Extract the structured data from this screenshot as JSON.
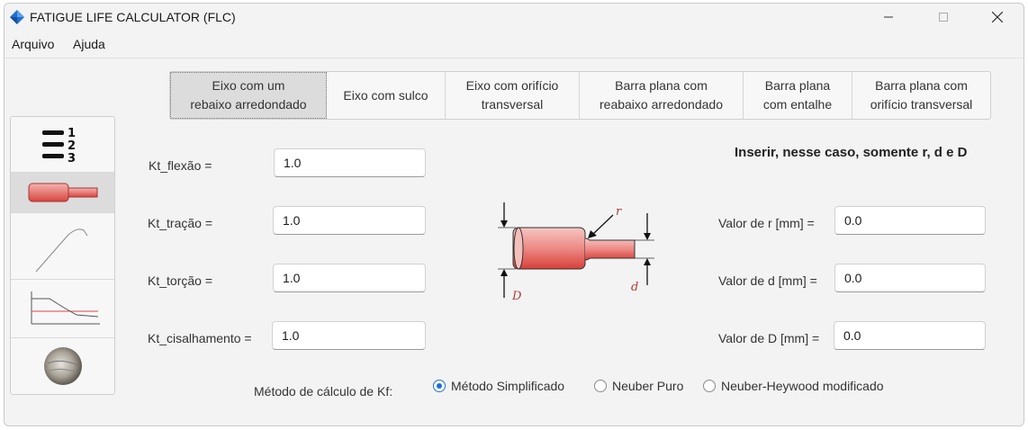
{
  "window": {
    "title": "FATIGUE LIFE CALCULATOR (FLC)"
  },
  "menu": [
    "Arquivo",
    "Ajuda"
  ],
  "tabs": [
    {
      "line1": "Eixo com um",
      "line2": "rebaixo arredondado",
      "active": true
    },
    {
      "line1": "Eixo com sulco",
      "line2": "",
      "active": false
    },
    {
      "line1": "Eixo com orifício",
      "line2": "transversal",
      "active": false
    },
    {
      "line1": "Barra plana com",
      "line2": "reabaixo arredondado",
      "active": false
    },
    {
      "line1": "Barra plana",
      "line2": "com entalhe",
      "active": false
    },
    {
      "line1": "Barra plana com",
      "line2": "orifício transversal",
      "active": false
    }
  ],
  "sidebar": [
    {
      "icon": "numbered-list-icon"
    },
    {
      "icon": "stepped-shaft-icon",
      "active": true
    },
    {
      "icon": "stress-strain-curve-icon"
    },
    {
      "icon": "fatigue-curve-icon"
    },
    {
      "icon": "fracture-surface-icon"
    }
  ],
  "kt": [
    {
      "label": "Kt_flexão =",
      "value": "1.0"
    },
    {
      "label": "Kt_tração =",
      "value": "1.0"
    },
    {
      "label": "Kt_torção =",
      "value": "1.0"
    },
    {
      "label": "Kt_cisalhamento =",
      "value": "1.0"
    }
  ],
  "hint": "Inserir, nesse caso, somente r, d e D",
  "diagram": {
    "r": "r",
    "d": "d",
    "D": "D"
  },
  "dims": [
    {
      "label": "Valor de r [mm] =",
      "value": "0.0"
    },
    {
      "label": "Valor de d [mm] =",
      "value": "0.0"
    },
    {
      "label": "Valor de D [mm] =",
      "value": "0.0"
    }
  ],
  "method": {
    "label": "Método de cálculo de Kf:",
    "options": [
      {
        "label": "Método Simplificado",
        "selected": true
      },
      {
        "label": "Neuber Puro",
        "selected": false
      },
      {
        "label": "Neuber-Heywood modificado",
        "selected": false
      }
    ]
  }
}
